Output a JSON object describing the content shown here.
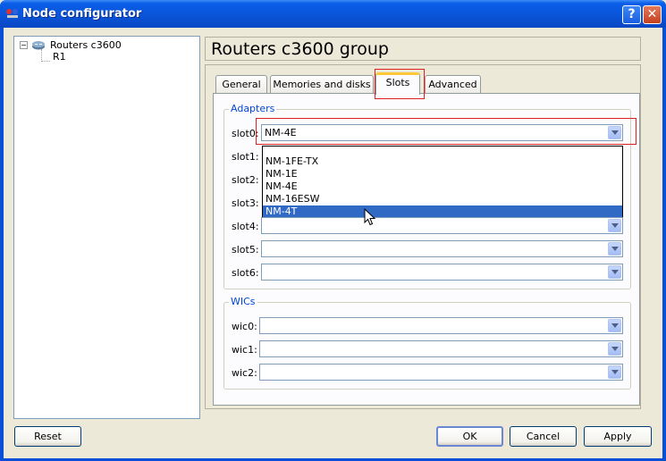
{
  "window": {
    "title": "Node configurator"
  },
  "tree": {
    "root_label": "Routers c3600",
    "expander": "−",
    "child_label": "R1"
  },
  "group_title": "Routers c3600 group",
  "tabs": [
    {
      "label": "General"
    },
    {
      "label": "Memories and disks"
    },
    {
      "label": "Slots"
    },
    {
      "label": "Advanced"
    }
  ],
  "active_tab": "Slots",
  "adapters": {
    "title": "Adapters",
    "slots": [
      {
        "label": "slot0:",
        "value": "NM-4E"
      },
      {
        "label": "slot1:",
        "value": ""
      },
      {
        "label": "slot2:",
        "value": ""
      },
      {
        "label": "slot3:",
        "value": ""
      },
      {
        "label": "slot4:",
        "value": ""
      },
      {
        "label": "slot5:",
        "value": ""
      },
      {
        "label": "slot6:",
        "value": ""
      }
    ]
  },
  "dropdown": {
    "options": [
      "",
      "NM-1FE-TX",
      "NM-1E",
      "NM-4E",
      "NM-16ESW",
      "NM-4T"
    ],
    "highlighted": "NM-4T"
  },
  "wics": {
    "title": "WICs",
    "slots": [
      {
        "label": "wic0:",
        "value": ""
      },
      {
        "label": "wic1:",
        "value": ""
      },
      {
        "label": "wic2:",
        "value": ""
      }
    ]
  },
  "buttons": {
    "reset": "Reset",
    "ok": "OK",
    "cancel": "Cancel",
    "apply": "Apply"
  },
  "title_buttons": {
    "help": "?",
    "close": "✕"
  },
  "colors": {
    "title_bar": "#0a53d7",
    "selection": "#316ac5",
    "highlight_box": "#e02020",
    "tab_accent": "#ffc73c",
    "group_label": "#0046d5"
  }
}
